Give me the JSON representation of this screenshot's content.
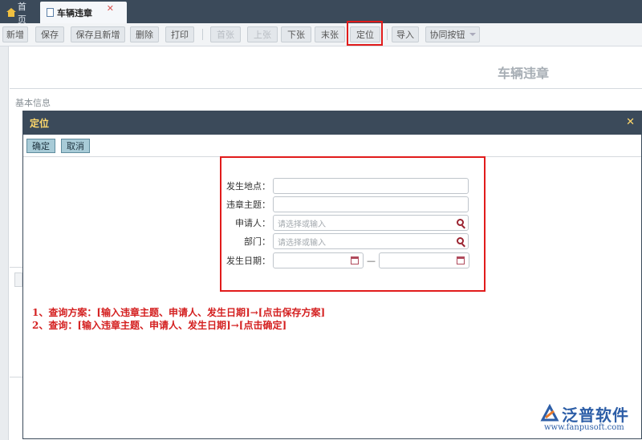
{
  "tabs": {
    "home": "首页",
    "active": "车辆违章",
    "close": "✕"
  },
  "toolbar": {
    "new": "新增",
    "save": "保存",
    "save_new": "保存且新增",
    "delete": "删除",
    "print": "打印",
    "first": "首张",
    "prev": "上张",
    "next": "下张",
    "last": "末张",
    "locate": "定位",
    "import": "导入",
    "assist": "协同按钮"
  },
  "form": {
    "title": "车辆违章",
    "section": "基本信息"
  },
  "dialog": {
    "title": "定位",
    "close": "✕",
    "confirm": "确定",
    "cancel": "取消",
    "fields": {
      "location": "发生地点：",
      "subject": "违章主题：",
      "applicant": "申请人：",
      "applicant_placeholder": "请选择或输入",
      "department": "部门：",
      "department_placeholder": "请选择或输入",
      "date": "发生日期：",
      "date_sep": "—"
    }
  },
  "notes": [
    "1、查询方案：[输入违章主题、申请人、发生日期]→[点击保存方案]",
    "2、查询：[输入违章主题、申请人、发生日期]→[点击确定]"
  ],
  "logo": {
    "name": "泛普软件",
    "url": "www.fanpusoft.com"
  },
  "colors": {
    "header": "#3b4a5a",
    "highlight": "#e11b1b",
    "dialog_title": "#ffd86b",
    "brand": "#2d5ea7"
  }
}
